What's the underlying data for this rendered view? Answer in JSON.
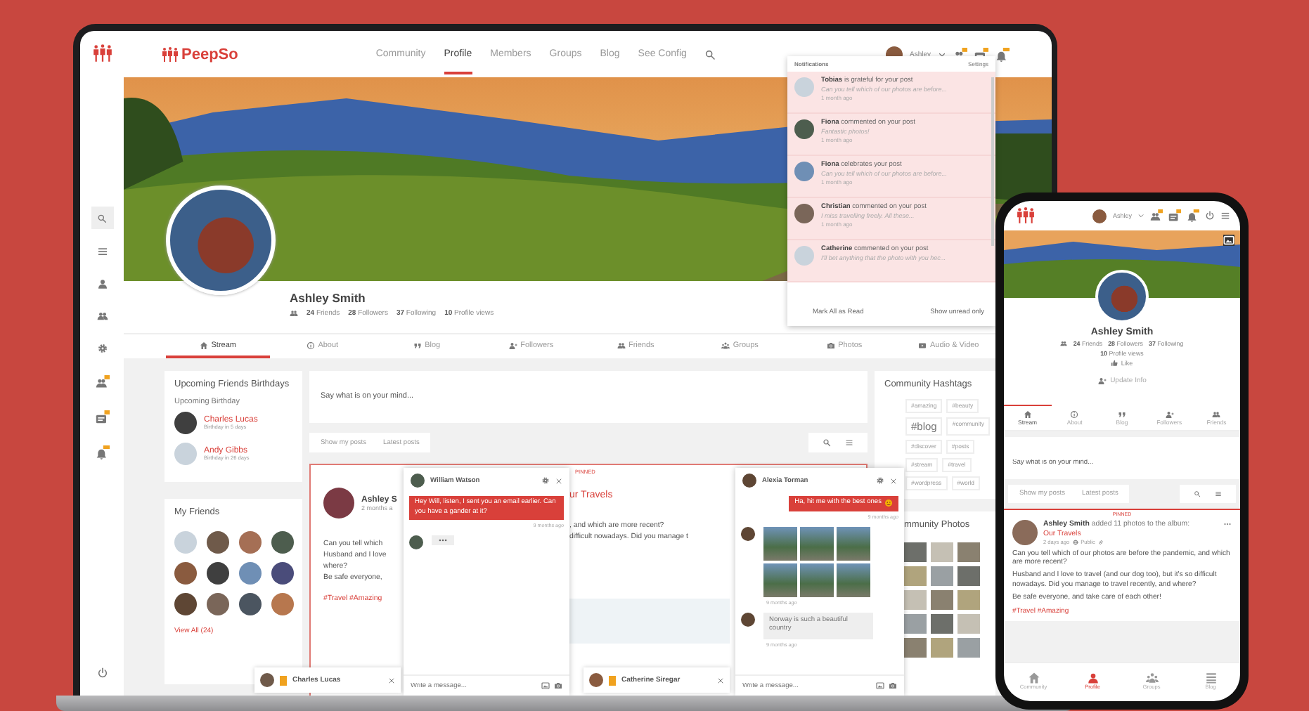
{
  "laptop": {
    "brand": "PeepSo",
    "nav": [
      {
        "label": "Community",
        "selected": false
      },
      {
        "label": "Profile",
        "selected": true
      },
      {
        "label": "Members",
        "selected": false
      },
      {
        "label": "Groups",
        "selected": false
      },
      {
        "label": "Blog",
        "selected": false
      },
      {
        "label": "See Config",
        "selected": false
      }
    ],
    "user": "Ashley",
    "profile": {
      "name": "Ashley Smith",
      "stats": [
        {
          "count": "24",
          "label": "Friends"
        },
        {
          "count": "28",
          "label": "Followers"
        },
        {
          "count": "37",
          "label": "Following"
        },
        {
          "count": "10",
          "label": "Profile views"
        }
      ]
    },
    "tabs": [
      {
        "label": "Stream",
        "selected": true
      },
      {
        "label": "About",
        "selected": false
      },
      {
        "label": "Blog",
        "selected": false
      },
      {
        "label": "Followers",
        "selected": false
      },
      {
        "label": "Friends",
        "selected": false
      },
      {
        "label": "Groups",
        "selected": false
      },
      {
        "label": "Photos",
        "selected": false
      },
      {
        "label": "Audio & Video",
        "selected": false
      }
    ],
    "birthdays": {
      "title": "Upcoming Friends Birthdays",
      "subtitle": "Upcoming Birthday",
      "people": [
        {
          "name": "Charles Lucas",
          "note": "Birthday in 5 days"
        },
        {
          "name": "Andy Gibbs",
          "note": "Birthday in 26 days"
        }
      ]
    },
    "friends": {
      "title": "My Friends",
      "link": "View All (24)"
    },
    "composer": {
      "placeholder": "Say what is on your mind..."
    },
    "filters": [
      "Show my posts",
      "Latest posts"
    ],
    "post": {
      "badge": "PINNED",
      "author": "Ashley S",
      "time": "2 months a",
      "album": "ur Travels",
      "left_lines": [
        "Can you tell which",
        "Husband and I love",
        "where?",
        "Be safe everyone,"
      ],
      "right_lines": [
        ", and which are more recent?",
        "difficult nowadays. Did you manage t"
      ],
      "hashtags": "#Travel #Amazing"
    },
    "hashtags": {
      "title": "Community Hashtags",
      "tags": [
        {
          "label": "#amazing",
          "kind": "small"
        },
        {
          "label": "#beauty",
          "kind": "small"
        },
        {
          "label": "#blog",
          "kind": "large"
        },
        {
          "label": "#community",
          "kind": "small"
        },
        {
          "label": "#discover",
          "kind": "small"
        },
        {
          "label": "#posts",
          "kind": "small"
        },
        {
          "label": "#stream",
          "kind": "small"
        },
        {
          "label": "#travel",
          "kind": "small"
        },
        {
          "label": "#wordpress",
          "kind": "small"
        },
        {
          "label": "#world",
          "kind": "small"
        }
      ]
    },
    "photos": {
      "title": "mmunity Photos"
    },
    "notifications": {
      "title": "Notifications",
      "settings": "Settings",
      "items": [
        {
          "text": "**Tobias** is grateful for your post",
          "excerpt": "Can you tell which of our photos are before...",
          "time": "1 month ago"
        },
        {
          "text": "**Fiona** commented on your post",
          "excerpt": "Fantastic photos!",
          "time": "1 month ago"
        },
        {
          "text": "**Fiona** celebrates your post",
          "excerpt": "Can you tell which of our photos are before...",
          "time": "1 month ago"
        },
        {
          "text": "**Christian** commented on your post",
          "excerpt": "I miss travelling freely. All these...",
          "time": "1 month ago"
        },
        {
          "text": "**Catherine** commented on your post",
          "excerpt": "I'll bet anything that the photo with you hec..."
        }
      ],
      "footer": [
        "Mark All as Read",
        "Show unread only"
      ]
    },
    "chats": [
      {
        "name": "William Watson",
        "placeholder": "Write a message...",
        "messages": [
          {
            "kind": "out",
            "text": "Hey Will, listen, I sent you an email earlier. Can you have a gander at it?",
            "time": "9 months ago"
          },
          {
            "kind": "typing"
          }
        ]
      },
      {
        "name": "Alexia Torman",
        "placeholder": "Write a message...",
        "messages": [
          {
            "kind": "out",
            "text": "Ha, hit me with the best ones",
            "time": "9 months ago"
          },
          {
            "kind": "photos",
            "time": "9 months ago"
          },
          {
            "kind": "in",
            "text": "Norway is such a beautiful country",
            "time": "9 months ago"
          }
        ]
      }
    ],
    "chat_bars": [
      {
        "name": "Charles Lucas"
      },
      {
        "name": "Catherine Siregar"
      }
    ]
  },
  "phone": {
    "user": "Ashley",
    "profile": {
      "name": "Ashley Smith",
      "stats": [
        {
          "count": "24",
          "label": "Friends"
        },
        {
          "count": "28",
          "label": "Followers"
        },
        {
          "count": "37",
          "label": "Following"
        }
      ],
      "views": {
        "count": "10",
        "label": "Profile views"
      },
      "like": "Like",
      "update": "Update Info"
    },
    "tabs": [
      {
        "label": "Stream",
        "selected": true
      },
      {
        "label": "About",
        "selected": false
      },
      {
        "label": "Blog",
        "selected": false
      },
      {
        "label": "Followers",
        "selected": false
      },
      {
        "label": "Friends",
        "selected": false
      }
    ],
    "composer": {
      "placeholder": "Say what is on your mind..."
    },
    "filters": [
      "Show my posts",
      "Latest posts"
    ],
    "post": {
      "badge": "PINNED",
      "header": "**Ashley Smith** added 11 photos to the album:",
      "album": "Our Travels",
      "time": "2 days ago",
      "privacy": "Public",
      "body": [
        "Can you tell which of our photos are before the pandemic, and which are more recent?",
        "Husband and I love to travel (and our dog too), but it's so difficult nowadays. Did you manage to travel recently, and where?",
        "Be safe everyone, and take care of each other!"
      ],
      "hashtags": "#Travel #Amazing"
    },
    "bottom_nav": [
      {
        "label": "Community",
        "selected": false
      },
      {
        "label": "Profile",
        "selected": true
      },
      {
        "label": "Groups",
        "selected": false
      },
      {
        "label": "Blog",
        "selected": false
      }
    ]
  }
}
